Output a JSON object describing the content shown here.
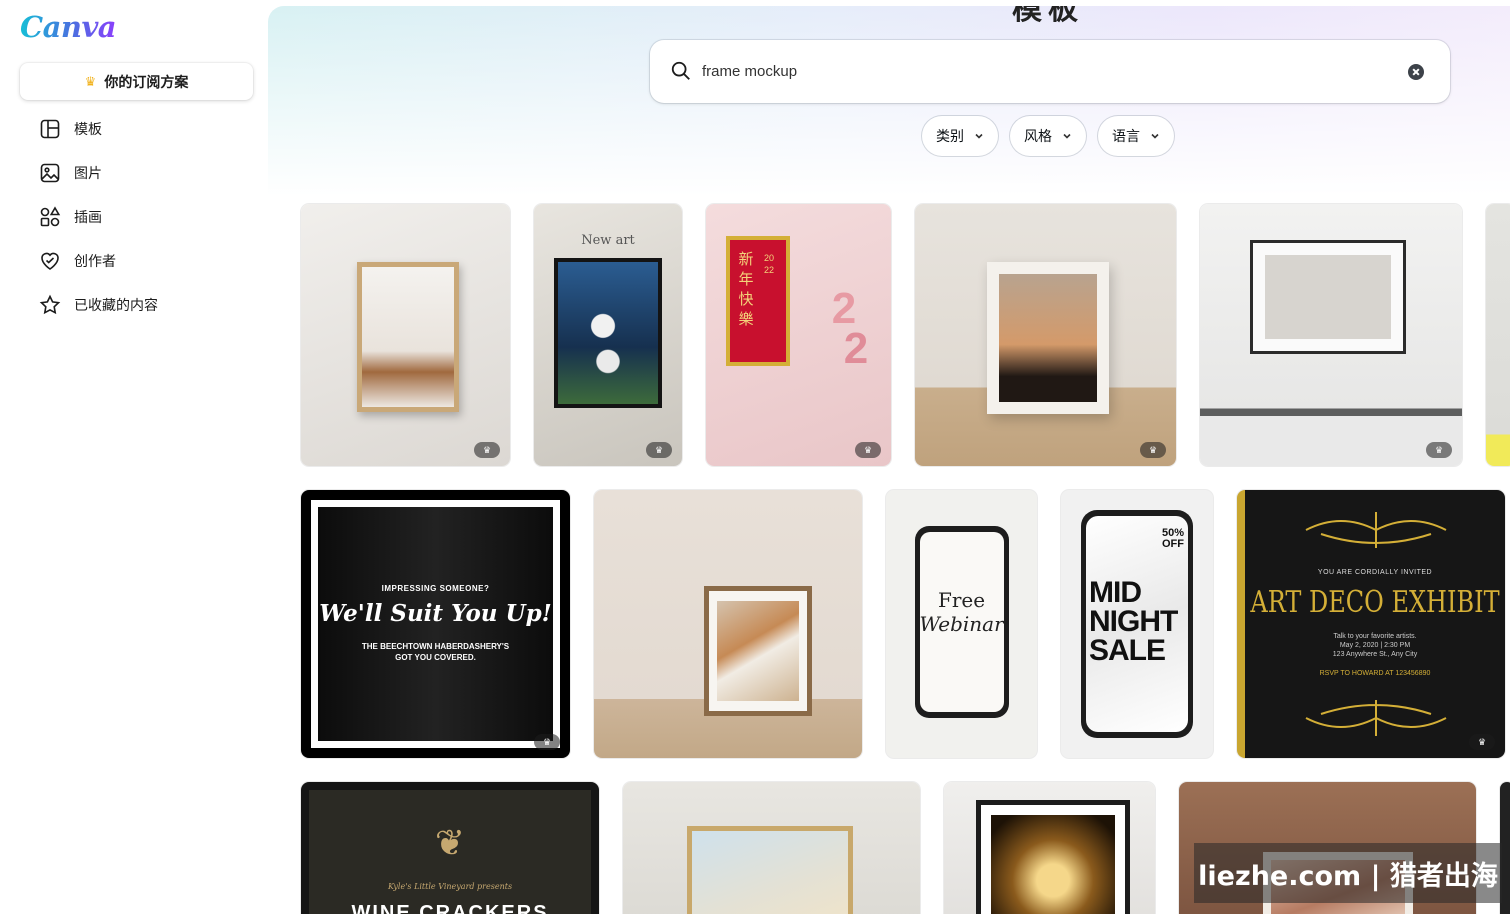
{
  "app": {
    "logo_text": "Canva"
  },
  "sidebar": {
    "plan_button": "你的订阅方案",
    "items": [
      {
        "label": "模板",
        "icon": "template-icon"
      },
      {
        "label": "图片",
        "icon": "image-icon"
      },
      {
        "label": "插画",
        "icon": "shapes-icon"
      },
      {
        "label": "创作者",
        "icon": "heart-creator-icon"
      },
      {
        "label": "已收藏的内容",
        "icon": "star-icon"
      }
    ]
  },
  "header": {
    "title": "模板"
  },
  "search": {
    "value": "frame mockup",
    "placeholder": ""
  },
  "filters": [
    {
      "label": "类别"
    },
    {
      "label": "风格"
    },
    {
      "label": "语言"
    }
  ],
  "templates": [
    {
      "id": 1,
      "premium": true
    },
    {
      "id": 2,
      "premium": true,
      "texts": {
        "headline": "New art"
      }
    },
    {
      "id": 3,
      "premium": true,
      "texts": {
        "chars": "新年快樂",
        "year": "2022"
      }
    },
    {
      "id": 4,
      "premium": true
    },
    {
      "id": 5,
      "premium": true
    },
    {
      "id": 7,
      "premium": true,
      "texts": {
        "kicker": "IMPRESSING SOMEONE?",
        "headline": "We'll Suit You Up!",
        "sub1": "THE BEECHTOWN HABERDASHERY'S",
        "sub2": "GOT YOU COVERED."
      }
    },
    {
      "id": 8,
      "premium": false
    },
    {
      "id": 9,
      "premium": false,
      "texts": {
        "line1": "Free",
        "line2": "Webinar"
      }
    },
    {
      "id": 10,
      "premium": false,
      "texts": {
        "offer": "50% OFF",
        "line1": "MID",
        "line2": "NIGHT",
        "line3": "SALE"
      }
    },
    {
      "id": 11,
      "premium": true,
      "texts": {
        "invite": "YOU ARE CORDIALLY INVITED",
        "headline": "ART DECO EXHIBIT",
        "d1": "Talk to your favorite artists.",
        "d2": "May 2, 2020 | 2:30 PM",
        "d3": "123 Anywhere St., Any City",
        "rsvp": "RSVP TO HOWARD AT 123456890"
      }
    },
    {
      "id": 13,
      "premium": false,
      "texts": {
        "presenter": "Kyle's Little Vineyard presents",
        "headline": "WINE CRACKERS"
      }
    },
    {
      "id": 14,
      "premium": false
    },
    {
      "id": 15,
      "premium": false
    },
    {
      "id": 16,
      "premium": false
    }
  ],
  "watermark": {
    "text": "liezhe.com | 猎者出海"
  },
  "colors": {
    "gold": "#d4af37",
    "red": "#c8102e",
    "dark": "#161616"
  }
}
